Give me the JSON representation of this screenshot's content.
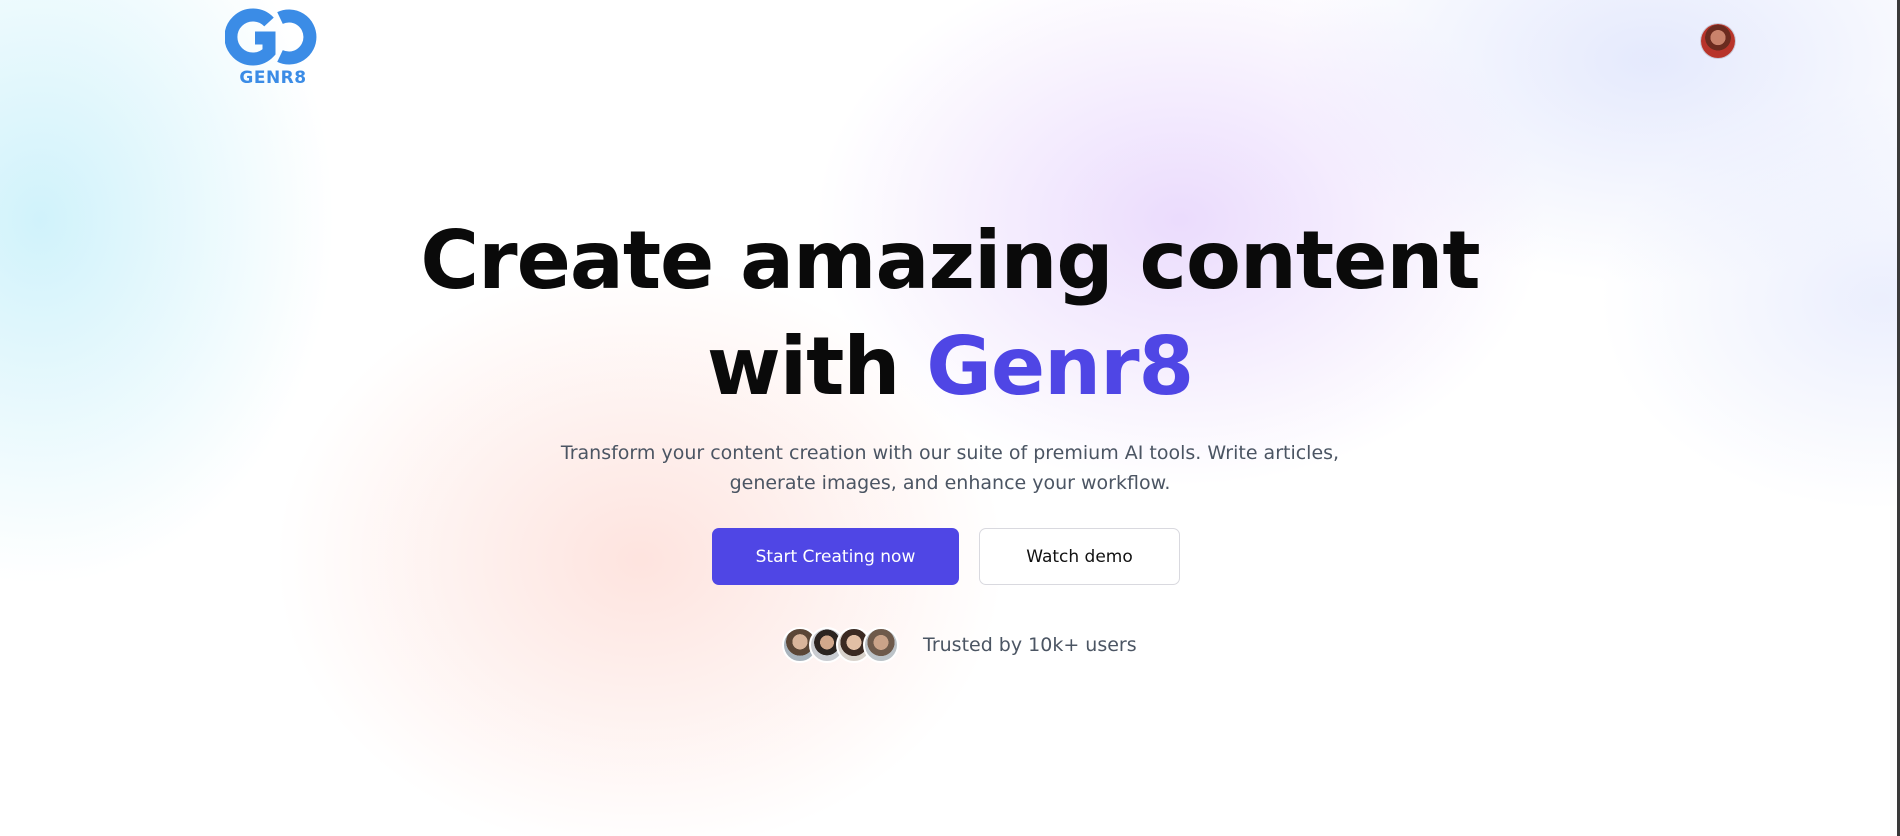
{
  "header": {
    "logo_text": "GENR8",
    "brand_color": "#3b8ce6",
    "profile_avatar_icon": "user-avatar"
  },
  "hero": {
    "title_line1": "Create amazing content",
    "title_line2_prefix": "with ",
    "title_line2_accent": "Genr8",
    "accent_color": "#4f46e5",
    "subtitle_line1": "Transform your content creation with our suite of premium AI tools. Write articles,",
    "subtitle_line2": "generate images, and enhance your workflow."
  },
  "actions": {
    "primary_label": "Start Creating now",
    "secondary_label": "Watch demo"
  },
  "social_proof": {
    "avatars": [
      "user-face",
      "user-face",
      "user-face",
      "user-face"
    ],
    "text": "Trusted by 10k+ users"
  }
}
